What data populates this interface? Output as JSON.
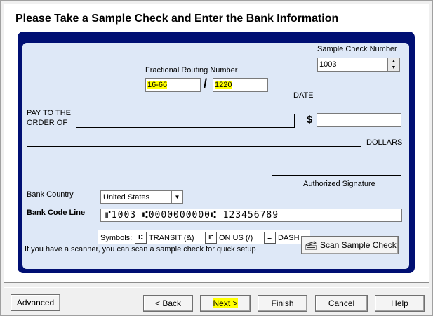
{
  "heading": "Please Take a Sample Check and Enter the Bank Information",
  "check": {
    "sample_check_number_label": "Sample Check Number",
    "sample_check_number_value": "1003",
    "fractional_routing_label": "Fractional Routing Number",
    "fractional_left": "16-66",
    "fractional_slash": "/",
    "fractional_right": "1220",
    "date_label": "DATE",
    "pay_to_line1": "PAY TO THE",
    "pay_to_line2": "ORDER OF",
    "dollar_sign": "$",
    "dollars_label": "DOLLARS",
    "authorized_signature": "Authorized Signature",
    "bank_country_label": "Bank Country",
    "bank_country_value": "United States",
    "bank_code_line_label": "Bank Code Line",
    "bank_code_line_value": "⑈1003 ⑆0000000000⑆ 123456789",
    "symbols_label": "Symbols:",
    "transit_label": "TRANSIT (&)",
    "on_us_label": "ON US (/)",
    "dash_label": "DASH",
    "transit_glyph": "⑆",
    "on_us_glyph": "⑈",
    "dash_glyph": "⑉",
    "scanner_hint": "If you have a scanner, you can scan a sample check for quick setup",
    "scan_button": "Scan Sample Check"
  },
  "footer": {
    "advanced": "Advanced",
    "back": "< Back",
    "next": "Next >",
    "finish": "Finish",
    "cancel": "Cancel",
    "help": "Help"
  },
  "colors": {
    "check_border": "#000f73",
    "check_fill": "#dee8f7",
    "highlight": "#ffff00"
  }
}
